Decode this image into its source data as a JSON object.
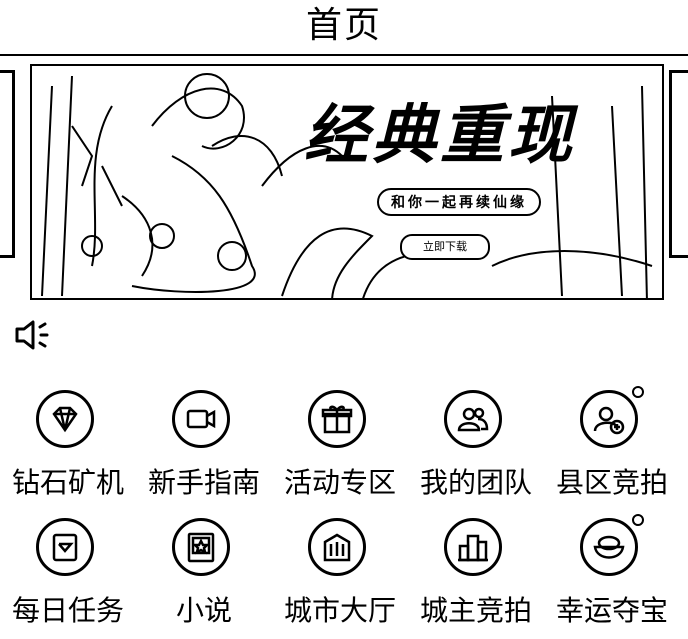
{
  "header": {
    "title": "首页"
  },
  "banner": {
    "headline": "经典重现",
    "tagline": "和你一起再续仙缘",
    "button_text": "立即下载"
  },
  "notice": {
    "icon": "speaker-icon"
  },
  "menu": [
    {
      "label": "钻石矿机",
      "icon": "diamond-mine-icon"
    },
    {
      "label": "新手指南",
      "icon": "video-guide-icon"
    },
    {
      "label": "活动专区",
      "icon": "gift-icon"
    },
    {
      "label": "我的团队",
      "icon": "team-icon"
    },
    {
      "label": "县区竞拍",
      "icon": "add-user-icon"
    },
    {
      "label": "每日任务",
      "icon": "task-icon"
    },
    {
      "label": "小说",
      "icon": "book-icon"
    },
    {
      "label": "城市大厅",
      "icon": "city-hall-icon"
    },
    {
      "label": "城主竞拍",
      "icon": "city-lord-icon"
    },
    {
      "label": "幸运夺宝",
      "icon": "treasure-icon"
    }
  ]
}
